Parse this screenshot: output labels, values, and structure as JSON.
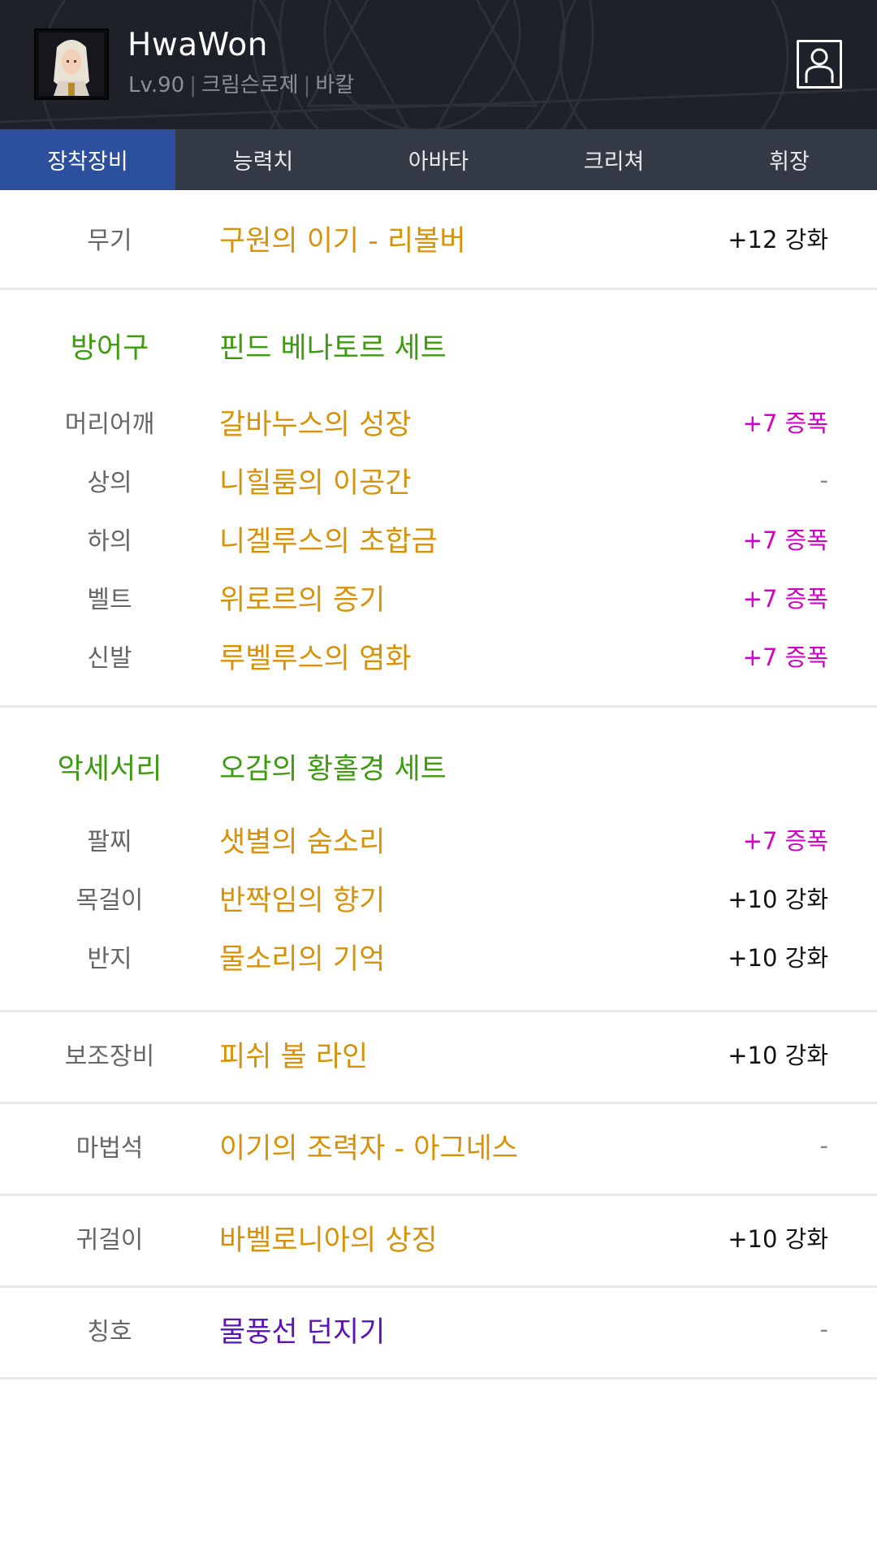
{
  "character": {
    "name": "HwaWon",
    "level": "Lv.90",
    "job": "크림슨로제",
    "server": "바칼"
  },
  "tabs": [
    {
      "label": "장착장비",
      "active": true
    },
    {
      "label": "능력치",
      "active": false
    },
    {
      "label": "아바타",
      "active": false
    },
    {
      "label": "크리쳐",
      "active": false
    },
    {
      "label": "휘장",
      "active": false
    }
  ],
  "weapon": {
    "slot": "무기",
    "item": "구원의 이기 - 리볼버",
    "grade": "+12 강화"
  },
  "armor": {
    "set_label": "방어구",
    "set_name": "핀드 베나토르 세트",
    "items": [
      {
        "slot": "머리어깨",
        "item": "갈바누스의 성장",
        "grade": "+7 증폭"
      },
      {
        "slot": "상의",
        "item": "니힐룸의 이공간",
        "grade": "-"
      },
      {
        "slot": "하의",
        "item": "니겔루스의 초합금",
        "grade": "+7 증폭"
      },
      {
        "slot": "벨트",
        "item": "위로르의 증기",
        "grade": "+7 증폭"
      },
      {
        "slot": "신발",
        "item": "루벨루스의 염화",
        "grade": "+7 증폭"
      }
    ]
  },
  "accessory": {
    "set_label": "악세서리",
    "set_name": "오감의 황홀경 세트",
    "items": [
      {
        "slot": "팔찌",
        "item": "샛별의 숨소리",
        "grade": "+7 증폭"
      },
      {
        "slot": "목걸이",
        "item": "반짝임의 향기",
        "grade": "+10 강화"
      },
      {
        "slot": "반지",
        "item": "물소리의 기억",
        "grade": "+10 강화"
      }
    ]
  },
  "sub_weapon": {
    "slot": "보조장비",
    "item": "피쉬 볼 라인",
    "grade": "+10 강화"
  },
  "magic_stone": {
    "slot": "마법석",
    "item": "이기의 조력자 - 아그네스",
    "grade": "-"
  },
  "earring": {
    "slot": "귀걸이",
    "item": "바벨로니아의 상징",
    "grade": "+10 강화"
  },
  "title": {
    "slot": "칭호",
    "item": "물풍선 던지기",
    "grade": "-"
  },
  "colors": {
    "header_bg": "#1e212a",
    "tab_bg": "#343946",
    "tab_active": "#2c4f9e",
    "item_epic": "#d8920a",
    "set_green": "#3c9b0e",
    "amplify_magenta": "#d400c8",
    "title_purple": "#5a14b8"
  },
  "icons": [
    "profile-icon",
    "character-portrait"
  ]
}
